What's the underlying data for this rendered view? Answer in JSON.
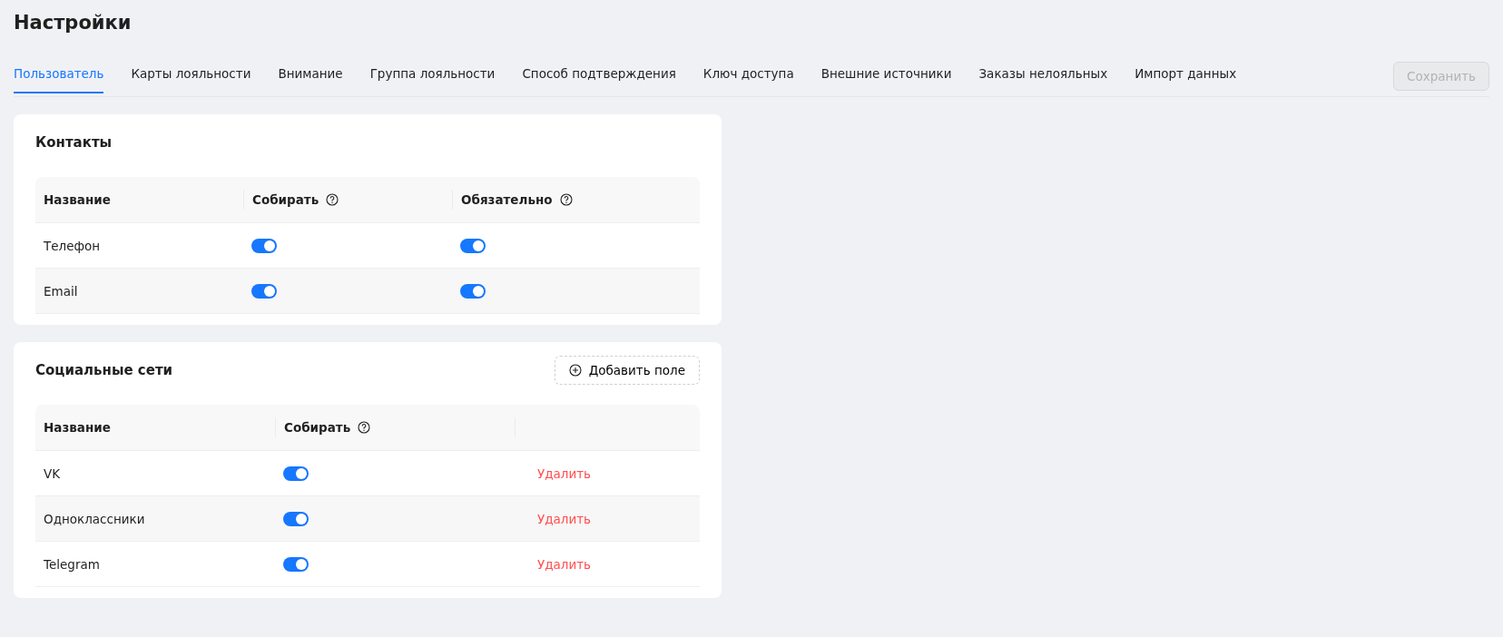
{
  "page_title": "Настройки",
  "tabs": [
    {
      "label": "Пользователь",
      "selected": true
    },
    {
      "label": "Карты лояльности",
      "selected": false
    },
    {
      "label": "Внимание",
      "selected": false
    },
    {
      "label": "Группа лояльности",
      "selected": false
    },
    {
      "label": "Способ подтверждения",
      "selected": false
    },
    {
      "label": "Ключ доступа",
      "selected": false
    },
    {
      "label": "Внешние источники",
      "selected": false
    },
    {
      "label": "Заказы нелояльных",
      "selected": false
    },
    {
      "label": "Импорт данных",
      "selected": false
    }
  ],
  "save_button": {
    "label": "Сохранить",
    "disabled": true
  },
  "contacts": {
    "title": "Контакты",
    "columns": [
      {
        "label": "Название",
        "help": false
      },
      {
        "label": "Собирать",
        "help": true
      },
      {
        "label": "Обязательно",
        "help": true
      }
    ],
    "rows": [
      {
        "name": "Телефон",
        "collect": true,
        "required": true
      },
      {
        "name": "Email",
        "collect": true,
        "required": true
      }
    ]
  },
  "social": {
    "title": "Социальные сети",
    "add_button": "Добавить поле",
    "columns": [
      {
        "label": "Название",
        "help": false
      },
      {
        "label": "Собирать",
        "help": true
      }
    ],
    "rows": [
      {
        "name": "VK",
        "collect": true,
        "action": "Удалить"
      },
      {
        "name": "Одноклассники",
        "collect": true,
        "action": "Удалить"
      },
      {
        "name": "Telegram",
        "collect": true,
        "action": "Удалить"
      }
    ]
  }
}
